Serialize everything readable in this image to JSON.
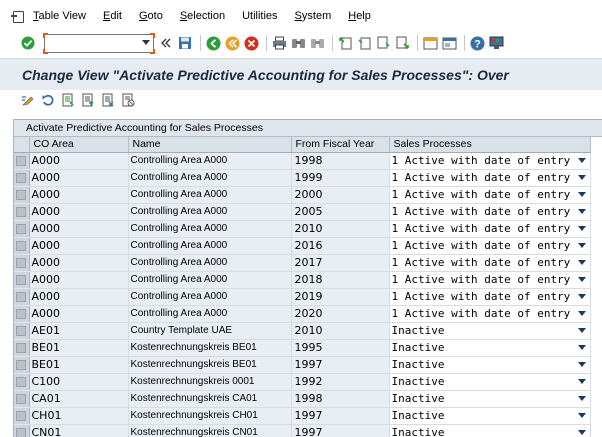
{
  "menu": {
    "items": [
      "Table View",
      "Edit",
      "Goto",
      "Selection",
      "Utilities",
      "System",
      "Help"
    ],
    "underline_first": [
      true,
      true,
      true,
      true,
      false,
      true,
      true
    ]
  },
  "toolbar": {
    "command_field_value": "",
    "icons": [
      "enter-icon",
      "save-icon",
      "back-icon",
      "exit-icon",
      "cancel-icon",
      "print-icon",
      "find-icon",
      "find-next-icon",
      "first-page-icon",
      "previous-page-icon",
      "next-page-icon",
      "last-page-icon",
      "create-session-icon",
      "shortcut-icon",
      "help-icon",
      "customize-layout-icon"
    ]
  },
  "title": "Change View \"Activate Predictive Accounting for Sales Processes\": Over",
  "apptoolbar": {
    "icons": [
      "display-change-icon",
      "undo-icon",
      "copy-entries-icon",
      "select-all-icon",
      "deselect-all-icon",
      "delete-icon"
    ]
  },
  "table": {
    "caption": "Activate Predictive Accounting for Sales Processes",
    "headers": [
      "CO Area",
      "Name",
      "From Fiscal Year",
      "Sales Processes"
    ],
    "rows": [
      [
        "A000",
        "Controlling Area A000",
        "1998",
        "1 Active with date of entry"
      ],
      [
        "A000",
        "Controlling Area A000",
        "1999",
        "1 Active with date of entry"
      ],
      [
        "A000",
        "Controlling Area A000",
        "2000",
        "1 Active with date of entry"
      ],
      [
        "A000",
        "Controlling Area A000",
        "2005",
        "1 Active with date of entry"
      ],
      [
        "A000",
        "Controlling Area A000",
        "2010",
        "1 Active with date of entry"
      ],
      [
        "A000",
        "Controlling Area A000",
        "2016",
        "1 Active with date of entry"
      ],
      [
        "A000",
        "Controlling Area A000",
        "2017",
        "1 Active with date of entry"
      ],
      [
        "A000",
        "Controlling Area A000",
        "2018",
        "1 Active with date of entry"
      ],
      [
        "A000",
        "Controlling Area A000",
        "2019",
        "1 Active with date of entry"
      ],
      [
        "A000",
        "Controlling Area A000",
        "2020",
        "1 Active with date of entry"
      ],
      [
        "AE01",
        "Country Template UAE",
        "2010",
        " Inactive"
      ],
      [
        "BE01",
        "Kostenrechnungskreis BE01",
        "1995",
        " Inactive"
      ],
      [
        "BE01",
        "Kostenrechnungskreis BE01",
        "1997",
        " Inactive"
      ],
      [
        "C100",
        "Kostenrechnungskreis 0001",
        "1992",
        " Inactive"
      ],
      [
        "CA01",
        "Kostenrechnungskreis CA01",
        "1998",
        " Inactive"
      ],
      [
        "CH01",
        "Kostenrechnungskreis CH01",
        "1997",
        " Inactive"
      ],
      [
        "CN01",
        "Kostenrechnungskreis CN01",
        "1997",
        " Inactive"
      ]
    ]
  },
  "colors": {
    "title_bg": "#e6ecf2",
    "header_bg": "#d9e1e9",
    "readonly_cell_bg": "#e8eef4",
    "accent_green": "#2e9e3a",
    "accent_orange": "#e8a020",
    "accent_red": "#d03020"
  }
}
